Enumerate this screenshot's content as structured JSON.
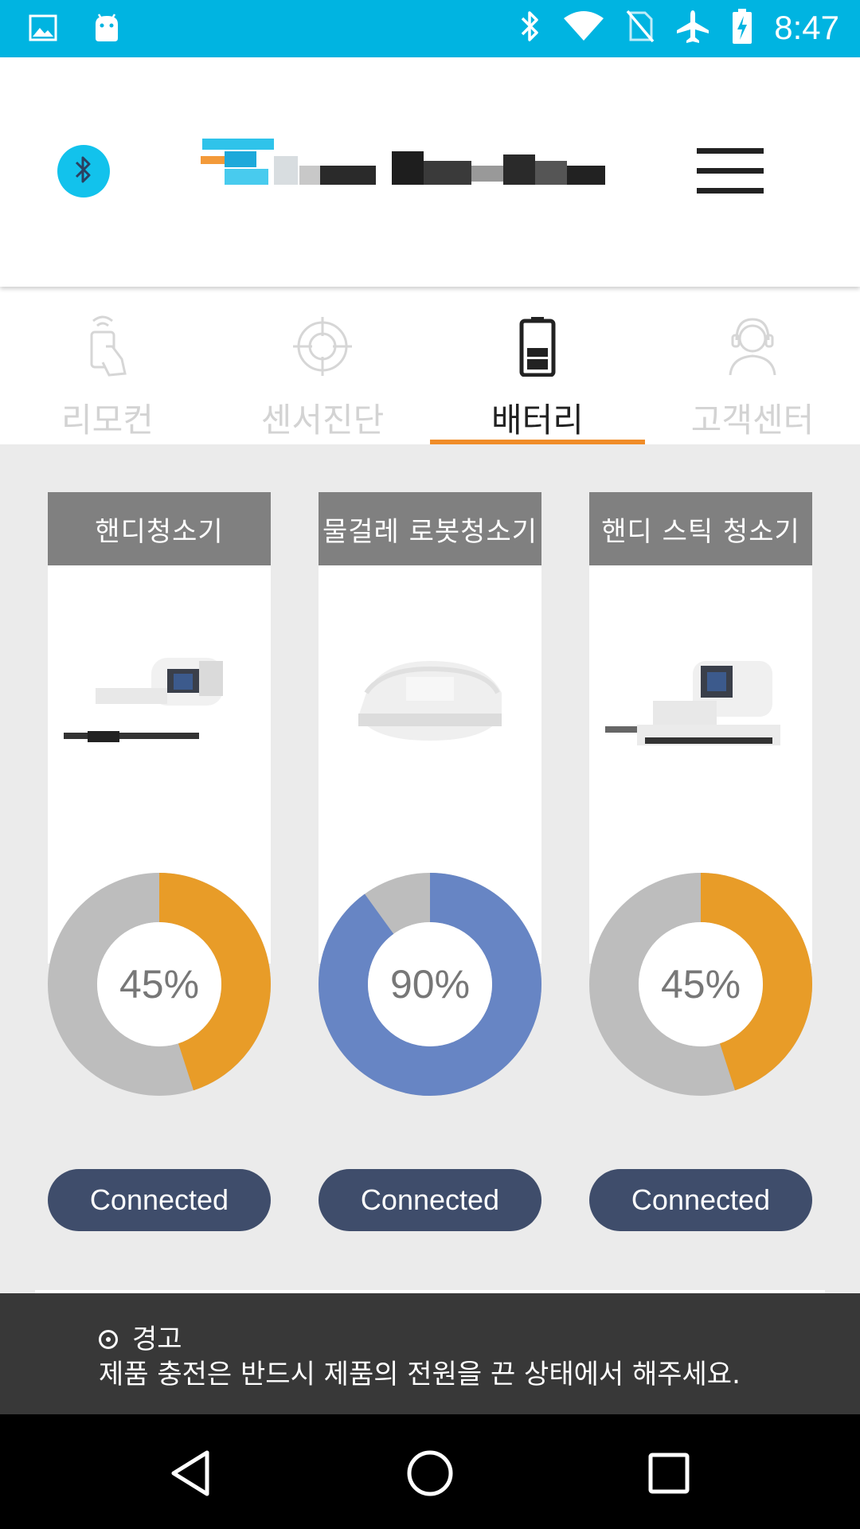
{
  "status_bar": {
    "time": "8:47",
    "left_icons": [
      "image-icon",
      "android-icon"
    ],
    "right_icons": [
      "bluetooth-icon",
      "wifi-icon",
      "no-sim-icon",
      "airplane-icon",
      "battery-charging-icon"
    ],
    "color": "#00b4e1"
  },
  "header": {
    "bluetooth_icon": "bluetooth-icon",
    "menu_icon": "hamburger-menu-icon"
  },
  "tabs": [
    {
      "label": "리모컨",
      "icon": "remote-touch-icon",
      "active": false
    },
    {
      "label": "센서진단",
      "icon": "target-icon",
      "active": false
    },
    {
      "label": "배터리",
      "icon": "battery-icon",
      "active": true
    },
    {
      "label": "고객센터",
      "icon": "headset-agent-icon",
      "active": false
    }
  ],
  "devices": [
    {
      "name": "핸디청소기",
      "battery_percent": 45,
      "battery_text": "45%",
      "status": "Connected",
      "color": "#e89c28"
    },
    {
      "name": "물걸레 로봇청소기",
      "battery_percent": 90,
      "battery_text": "90%",
      "status": "Connected",
      "color": "#6785c4"
    },
    {
      "name": "핸디 스틱 청소기",
      "battery_percent": 45,
      "battery_text": "45%",
      "status": "Connected",
      "color": "#e89c28"
    }
  ],
  "colors": {
    "active_tab_underline": "#f08c28",
    "donut_track": "#bdbdbd",
    "button_bg": "#3f4d6b"
  },
  "warning": {
    "title": "경고",
    "message": "제품 충전은 반드시 제품의 전원을 끈 상태에서 해주세요."
  },
  "nav": [
    "back-icon",
    "home-icon",
    "recents-icon"
  ]
}
